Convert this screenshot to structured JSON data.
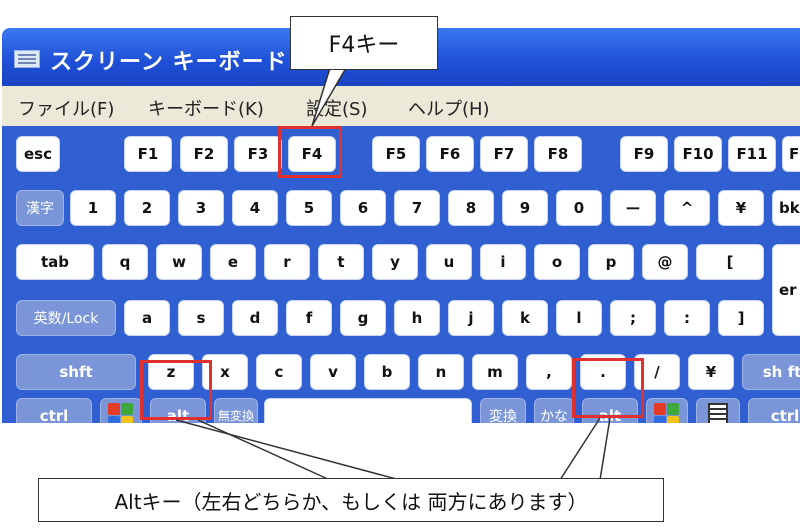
{
  "window": {
    "title": "スクリーン キーボード"
  },
  "menu": [
    "ファイル(F)",
    "キーボード(K)",
    "設定(S)",
    "ヘルプ(H)"
  ],
  "keys": {
    "row1": [
      "esc",
      "F1",
      "F2",
      "F3",
      "F4",
      "F5",
      "F6",
      "F7",
      "F8",
      "F9",
      "F10",
      "F11",
      "F"
    ],
    "row2": [
      "漢字",
      "1",
      "2",
      "3",
      "4",
      "5",
      "6",
      "7",
      "8",
      "9",
      "0",
      "ー",
      "^",
      "¥",
      "bk"
    ],
    "row3": [
      "tab",
      "q",
      "w",
      "e",
      "r",
      "t",
      "y",
      "u",
      "i",
      "o",
      "p",
      "@",
      "[",
      "er"
    ],
    "row4": [
      "英数/Lock",
      "a",
      "s",
      "d",
      "f",
      "g",
      "h",
      "j",
      "k",
      "l",
      ";",
      ":",
      "]"
    ],
    "row5": [
      "shft",
      "z",
      "x",
      "c",
      "v",
      "b",
      "n",
      "m",
      ",",
      ".",
      "/",
      "¥",
      "sh ft"
    ],
    "row6": [
      "ctrl",
      "alt",
      "無変換",
      "変換",
      "かな",
      "alt",
      "ctrl"
    ]
  },
  "annotations": {
    "f4_label": "F4キー",
    "alt_label": "Altキー（左右どちらか、もしくは 両方にあります）"
  },
  "colors": {
    "highlight": "#e0302f",
    "keyboard_bg": "#2f5fd0"
  }
}
